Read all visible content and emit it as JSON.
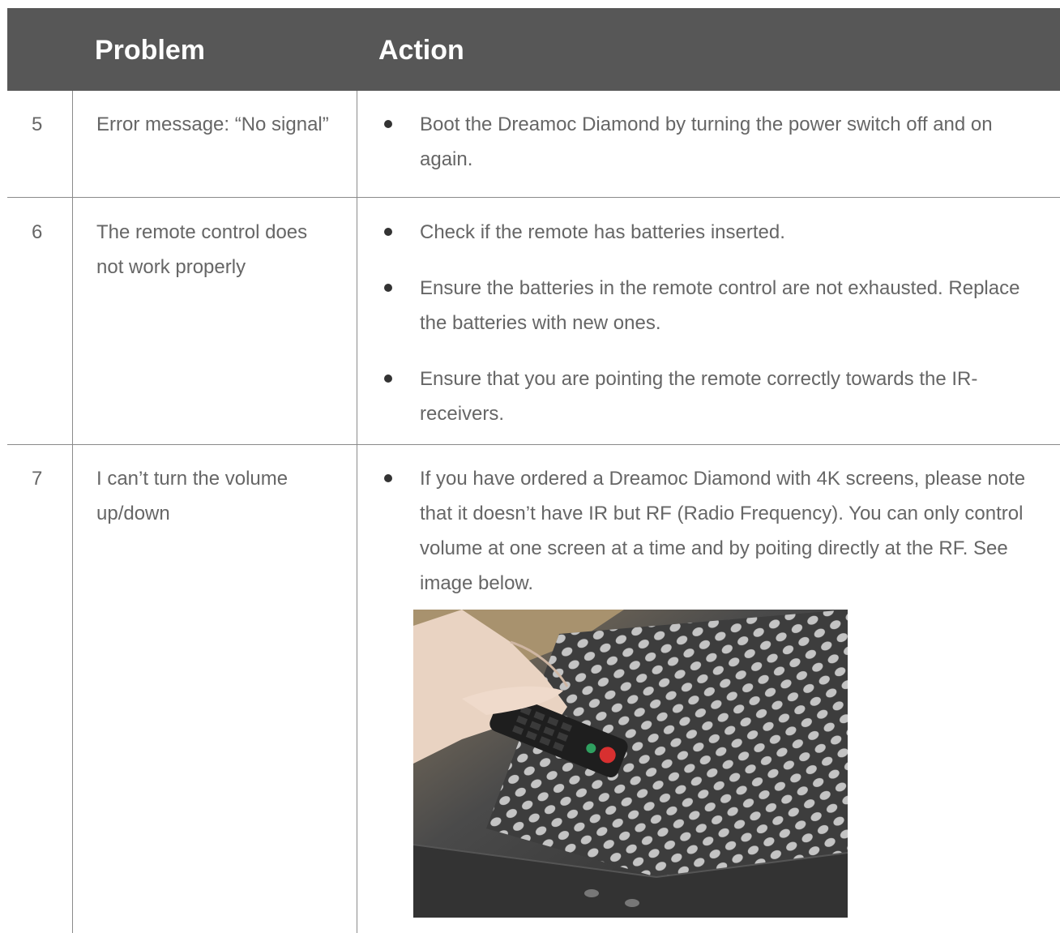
{
  "header": {
    "problem": "Problem",
    "action": "Action"
  },
  "rows": [
    {
      "number": "5",
      "problem": "Error message: “No signal”",
      "actions": [
        "Boot the Dreamoc Diamond by turning the power switch off and on again."
      ]
    },
    {
      "number": "6",
      "problem": "The remote control does not work properly",
      "actions": [
        "Check if the remote has batteries inserted.",
        "Ensure the batteries in the remote control are not exhausted. Replace the batteries with new ones.",
        "Ensure that you are pointing the remote correctly towards the IR-receivers."
      ]
    },
    {
      "number": "7",
      "problem": "I can’t turn the volume up/down",
      "actions": [
        "If you have ordered a Dreamoc Diamond with 4K screens, please note that it doesn’t have IR but RF (Radio Frequency). You can only control volume at one screen at a time and by poiting directly at the RF. See image below."
      ]
    }
  ]
}
